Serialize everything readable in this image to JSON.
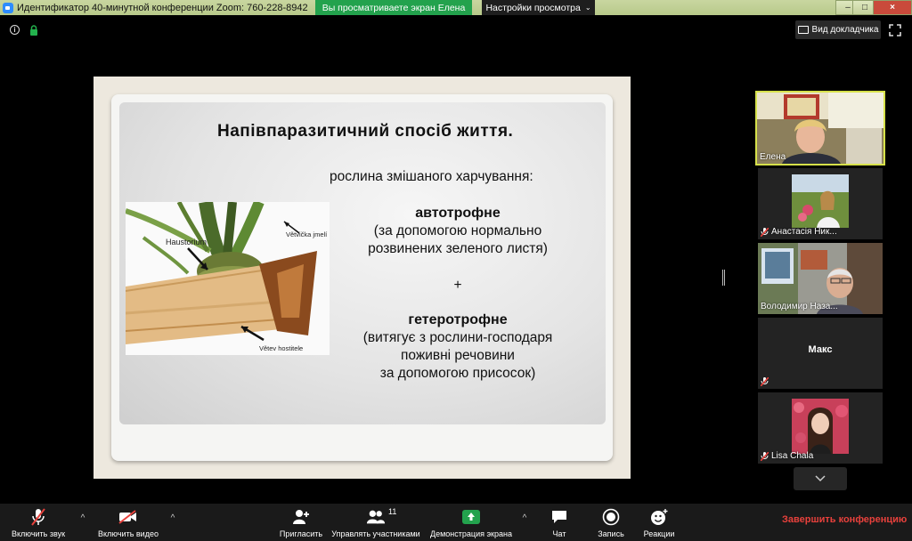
{
  "window": {
    "title": "Идентификатор 40-минутной конференции Zoom: 760-228-8942",
    "share_notice": "Вы просматриваете экран Елена",
    "view_options": "Настройки просмотра",
    "controls": [
      "–",
      "□",
      "×"
    ]
  },
  "top": {
    "speaker_view": "Вид докладчика"
  },
  "slide": {
    "title": "Напівпаразитичний  спосіб життя.",
    "subtitle": "рослина змішаного харчування:",
    "auto_head": "автотрофне",
    "auto_line1": "(за допомогою нормально",
    "auto_line2": "розвинених зеленого листя)",
    "plus": "+",
    "hetero_head": "гетеротрофне",
    "hetero_line1": "(витягує з рослини-господаря",
    "hetero_line2": "поживні речовини",
    "hetero_line3": "за допомогою присосок)",
    "photo_labels": {
      "haustorium": "Haustorium",
      "vetvicka": "Větvička jmelí",
      "vetev": "Větev hostitele"
    }
  },
  "participants": [
    {
      "name": "Елена",
      "muted": false
    },
    {
      "name": "Анастасія Ник...",
      "muted": true
    },
    {
      "name": "Володимир Наза...",
      "muted": false
    },
    {
      "name": "Макс",
      "muted": true
    },
    {
      "name": "Lisa Chala",
      "muted": true
    }
  ],
  "toolbar": {
    "audio": "Включить звук",
    "video": "Включить видео",
    "invite": "Пригласить",
    "participants": "Управлять участниками",
    "participants_count": "11",
    "share": "Демонстрация экрана",
    "chat": "Чат",
    "record": "Запись",
    "reactions": "Реакции",
    "end": "Завершить конференцию"
  },
  "colors": {
    "share_green": "#23a24d",
    "end_red": "#e8413c",
    "active_speaker_border": "#d6e14a"
  }
}
